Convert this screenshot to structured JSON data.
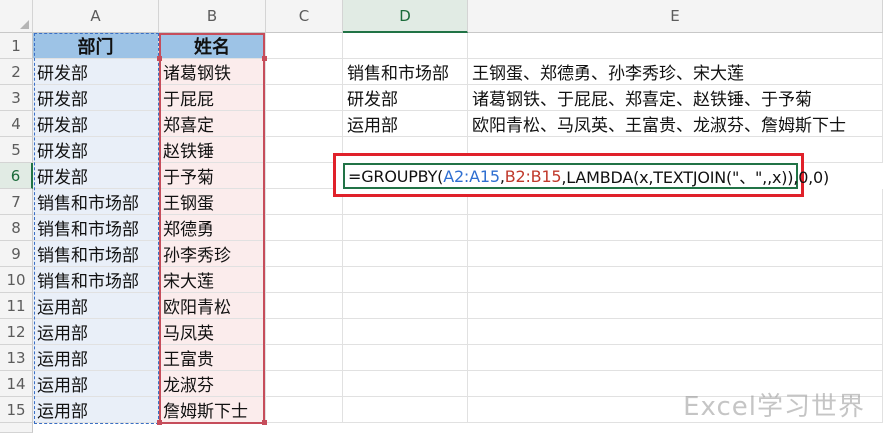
{
  "columns": [
    "A",
    "B",
    "C",
    "D",
    "E"
  ],
  "rows": [
    "1",
    "2",
    "3",
    "4",
    "5",
    "6",
    "7",
    "8",
    "9",
    "10",
    "11",
    "12",
    "13",
    "14",
    "15"
  ],
  "headers": {
    "dept": "部门",
    "name": "姓名"
  },
  "colA": [
    "研发部",
    "研发部",
    "研发部",
    "研发部",
    "研发部",
    "销售和市场部",
    "销售和市场部",
    "销售和市场部",
    "销售和市场部",
    "运用部",
    "运用部",
    "运用部",
    "运用部",
    "运用部"
  ],
  "colB": [
    "诸葛钢铁",
    "于屁屁",
    "郑喜定",
    "赵铁锤",
    "于予菊",
    "王钢蛋",
    "郑德勇",
    "孙李秀珍",
    "宋大莲",
    "欧阳青松",
    "马凤英",
    "王富贵",
    "龙淑芬",
    "詹姆斯下士"
  ],
  "result": [
    {
      "dept": "销售和市场部",
      "names": "王钢蛋、郑德勇、孙李秀珍、宋大莲"
    },
    {
      "dept": "研发部",
      "names": "诸葛钢铁、于屁屁、郑喜定、赵铁锤、于予菊"
    },
    {
      "dept": "运用部",
      "names": "欧阳青松、马凤英、王富贵、龙淑芬、詹姆斯下士"
    }
  ],
  "formula": {
    "p1": "=GROUPBY(",
    "ref1": "A2:A15",
    "comma1": ",",
    "ref2": "B2:B15",
    "p2": ",LAMBDA(x,TEXTJOIN(\"、\",,x)),0,0)"
  },
  "watermark": "Excel学习世界",
  "colors": {
    "header_fill": "#9dc3e6",
    "colA_fill": "#e9eff8",
    "colB_fill": "#fbecec",
    "highlight_box": "#e0212a",
    "edit_border": "#217346"
  }
}
